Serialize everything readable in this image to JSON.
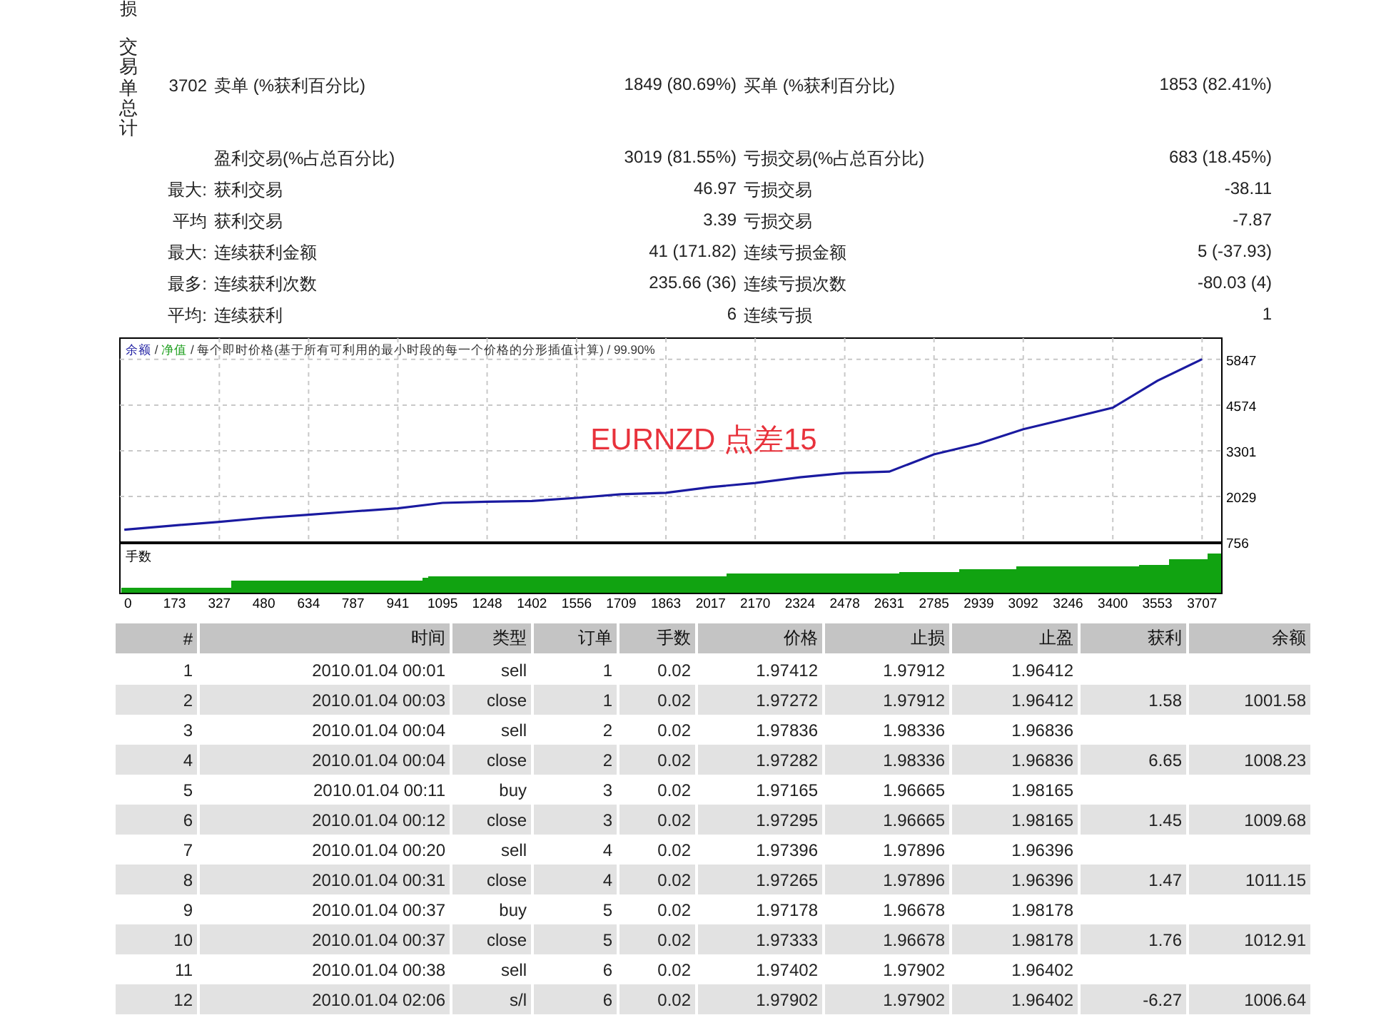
{
  "stats": {
    "cut_label": "损",
    "side_label": "交易单总计",
    "totals": {
      "count": "3702",
      "label": "卖单 (%获利百分比)",
      "value": "1849 (80.69%)",
      "label2": "买单 (%获利百分比)",
      "value2": "1853 (82.41%)"
    },
    "rows": [
      {
        "label": "盈利交易(%占总百分比)",
        "value": "3019 (81.55%)",
        "label2": "亏损交易(%占总百分比)",
        "value2": "683 (18.45%)"
      },
      {
        "prefix": "最大:",
        "label": "获利交易",
        "value": "46.97",
        "label2": "亏损交易",
        "value2": "-38.11"
      },
      {
        "prefix": "平均",
        "label": "获利交易",
        "value": "3.39",
        "label2": "亏损交易",
        "value2": "-7.87"
      },
      {
        "prefix": "最大:",
        "label": "连续获利金额",
        "value": "41 (171.82)",
        "label2": "连续亏损金额",
        "value2": "5 (-37.93)"
      },
      {
        "prefix": "最多:",
        "label": "连续获利次数",
        "value": "235.66 (36)",
        "label2": "连续亏损次数",
        "value2": "-80.03 (4)"
      },
      {
        "prefix": "平均:",
        "label": "连续获利",
        "value": "6",
        "label2": "连续亏损",
        "value2": "1"
      }
    ]
  },
  "chart": {
    "legend": [
      {
        "text": "/",
        "color": "#333333"
      },
      {
        "text": "净值",
        "color": "#20a020"
      },
      {
        "text": "/ 每个即时价格(基于所有可利用的最小时段的每一个价格的分形插值计算) / 99.90%",
        "color": "#333333"
      }
    ],
    "label": "EURNZD 点差15",
    "volume_label": "手数",
    "chart_data": {
      "type": "line",
      "grid": true,
      "xlim": [
        -15,
        3775
      ],
      "ylim": [
        756,
        6440
      ],
      "xticks": [
        0,
        173,
        327,
        480,
        634,
        787,
        941,
        1095,
        1248,
        1402,
        1556,
        1709,
        1863,
        2017,
        2170,
        2324,
        2478,
        2631,
        2785,
        2939,
        3092,
        3246,
        3400,
        3553,
        3707
      ],
      "yticks": [
        756,
        2029,
        3301,
        4574,
        5847
      ],
      "x": [
        0,
        173,
        327,
        480,
        634,
        787,
        941,
        1095,
        1248,
        1402,
        1556,
        1709,
        1863,
        2017,
        2170,
        2324,
        2478,
        2631,
        2785,
        2939,
        3092,
        3246,
        3400,
        3553,
        3707
      ],
      "series": [
        {
          "name": "余额",
          "color": "#1a1aa0",
          "values": [
            1100,
            1220,
            1320,
            1430,
            1520,
            1610,
            1700,
            1850,
            1880,
            1900,
            1990,
            2090,
            2130,
            2290,
            2400,
            2560,
            2680,
            2720,
            3200,
            3500,
            3900,
            4200,
            4500,
            5250,
            5850
          ]
        }
      ]
    }
  },
  "table": {
    "columns": [
      "#",
      "时间",
      "类型",
      "订单",
      "手数",
      "价格",
      "止损",
      "止盈",
      "获利",
      "余额"
    ],
    "rows": [
      [
        "1",
        "2010.01.04 00:01",
        "sell",
        "1",
        "0.02",
        "1.97412",
        "1.97912",
        "1.96412"
      ],
      [
        "2",
        "2010.01.04 00:03",
        "close",
        "1",
        "0.02",
        "1.97272",
        "1.97912",
        "1.96412",
        "1.58",
        "1001.58"
      ],
      [
        "3",
        "2010.01.04 00:04",
        "sell",
        "2",
        "0.02",
        "1.97836",
        "1.98336",
        "1.96836"
      ],
      [
        "4",
        "2010.01.04 00:04",
        "close",
        "2",
        "0.02",
        "1.97282",
        "1.98336",
        "1.96836",
        "6.65",
        "1008.23"
      ],
      [
        "5",
        "2010.01.04 00:11",
        "buy",
        "3",
        "0.02",
        "1.97165",
        "1.96665",
        "1.98165"
      ],
      [
        "6",
        "2010.01.04 00:12",
        "close",
        "3",
        "0.02",
        "1.97295",
        "1.96665",
        "1.98165",
        "1.45",
        "1009.68"
      ],
      [
        "7",
        "2010.01.04 00:20",
        "sell",
        "4",
        "0.02",
        "1.97396",
        "1.97896",
        "1.96396"
      ],
      [
        "8",
        "2010.01.04 00:31",
        "close",
        "4",
        "0.02",
        "1.97265",
        "1.97896",
        "1.96396",
        "1.47",
        "1011.15"
      ],
      [
        "9",
        "2010.01.04 00:37",
        "buy",
        "5",
        "0.02",
        "1.97178",
        "1.96678",
        "1.98178"
      ],
      [
        "10",
        "2010.01.04 00:37",
        "close",
        "5",
        "0.02",
        "1.97333",
        "1.96678",
        "1.98178",
        "1.76",
        "1012.91"
      ],
      [
        "11",
        "2010.01.04 00:38",
        "sell",
        "6",
        "0.02",
        "1.97402",
        "1.97902",
        "1.96402"
      ],
      [
        "12",
        "2010.01.04 02:06",
        "s/l",
        "6",
        "0.02",
        "1.97902",
        "1.97902",
        "1.96402",
        "-6.27",
        "1006.64"
      ]
    ]
  }
}
